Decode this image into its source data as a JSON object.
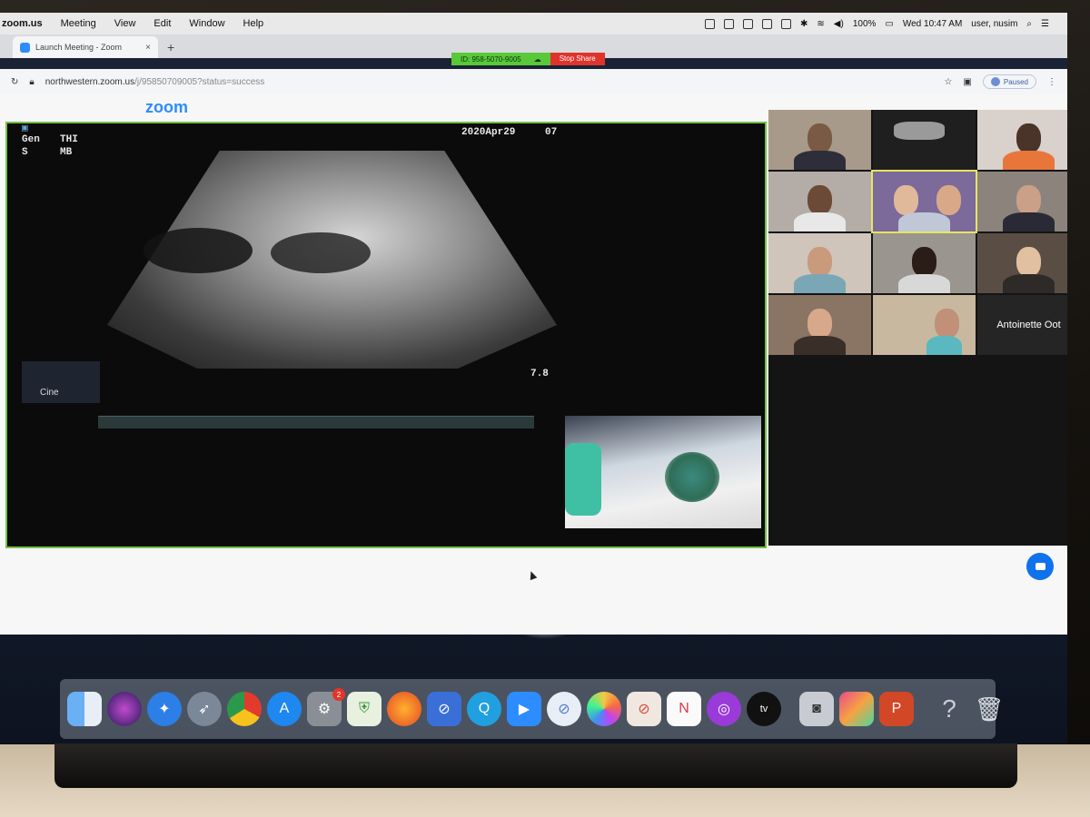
{
  "menubar": {
    "app_name": "zoom.us",
    "menus": [
      "Meeting",
      "View",
      "Edit",
      "Window",
      "Help"
    ],
    "battery": "100%",
    "clock": "Wed 10:47 AM",
    "user": "user, nusim"
  },
  "browser": {
    "tab_title": "Launch Meeting - Zoom",
    "tab_close": "×",
    "new_tab": "+",
    "url_host": "northwestern.zoom.us",
    "url_path": "/j/95850709005?status=success",
    "profile_status": "Paused"
  },
  "share_bar": {
    "meeting_id": "ID: 958-5070-9005",
    "stop_label": "Stop Share",
    "color_green": "#59c93a",
    "color_red": "#e0332b"
  },
  "page": {
    "logo": "zoom"
  },
  "ultrasound": {
    "gen_label": "Gen",
    "thi_label": "THI",
    "s_label": "S",
    "mb_label": "MB",
    "date": "2020Apr29",
    "time_fragment": "07",
    "depth": "7.8",
    "cine_label": "Cine"
  },
  "gallery": {
    "name_tile": "Antoinette Oot"
  },
  "dock": {
    "badge_count": "2"
  }
}
